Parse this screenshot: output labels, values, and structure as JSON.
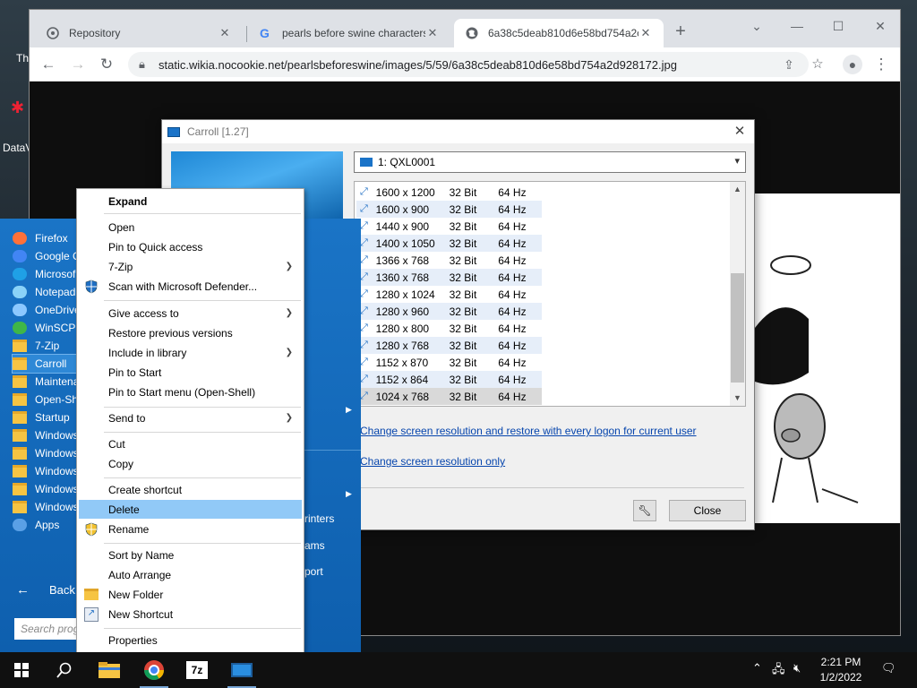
{
  "desktop": {
    "icons": [
      {
        "label": "Th"
      },
      {
        "label": "DataV"
      }
    ]
  },
  "browser": {
    "tabs": [
      {
        "label": "Repository",
        "icon": "repo-icon"
      },
      {
        "label": "pearls before swine characters -",
        "icon": "google-icon"
      },
      {
        "label": "6a38c5deab810d6e58bd754a2c",
        "icon": "globe-icon",
        "active": true
      }
    ],
    "url": "static.wikia.nocookie.net/pearlsbeforeswine/images/5/59/6a38c5deab810d6e58bd754a2d928172.jpg"
  },
  "carroll": {
    "title": "Carroll [1.27]",
    "display": "1: QXL0001",
    "resolutions": [
      {
        "res": "1600 x 1200",
        "bits": "32 Bit",
        "hz": "64 Hz"
      },
      {
        "res": "1600 x 900",
        "bits": "32 Bit",
        "hz": "64 Hz"
      },
      {
        "res": "1440 x 900",
        "bits": "32 Bit",
        "hz": "64 Hz"
      },
      {
        "res": "1400 x 1050",
        "bits": "32 Bit",
        "hz": "64 Hz"
      },
      {
        "res": "1366 x 768",
        "bits": "32 Bit",
        "hz": "64 Hz"
      },
      {
        "res": "1360 x 768",
        "bits": "32 Bit",
        "hz": "64 Hz"
      },
      {
        "res": "1280 x 1024",
        "bits": "32 Bit",
        "hz": "64 Hz"
      },
      {
        "res": "1280 x 960",
        "bits": "32 Bit",
        "hz": "64 Hz"
      },
      {
        "res": "1280 x 800",
        "bits": "32 Bit",
        "hz": "64 Hz"
      },
      {
        "res": "1280 x 768",
        "bits": "32 Bit",
        "hz": "64 Hz"
      },
      {
        "res": "1152 x 870",
        "bits": "32 Bit",
        "hz": "64 Hz"
      },
      {
        "res": "1152 x 864",
        "bits": "32 Bit",
        "hz": "64 Hz"
      },
      {
        "res": "1024 x 768",
        "bits": "32 Bit",
        "hz": "64 Hz",
        "selected": true
      }
    ],
    "link_restore": "Change screen resolution and restore with every logon for current user",
    "link_only": "Change screen resolution only",
    "close_label": "Close"
  },
  "startmenu": {
    "items": [
      {
        "label": "Firefox",
        "icon": "firefox-icon"
      },
      {
        "label": "Google C",
        "icon": "chrome-icon"
      },
      {
        "label": "Microsof",
        "icon": "edge-icon"
      },
      {
        "label": "Notepad",
        "icon": "notepad-icon"
      },
      {
        "label": "OneDrive",
        "icon": "onedrive-icon"
      },
      {
        "label": "WinSCP",
        "icon": "winscp-icon"
      },
      {
        "label": "7-Zip",
        "icon": "folder-icon"
      },
      {
        "label": "Carroll",
        "icon": "folder-icon",
        "selected": true
      },
      {
        "label": "Maintena",
        "icon": "folder-icon"
      },
      {
        "label": "Open-Sh",
        "icon": "folder-icon"
      },
      {
        "label": "Startup",
        "icon": "folder-icon"
      },
      {
        "label": "Windows",
        "icon": "folder-icon"
      },
      {
        "label": "Windows",
        "icon": "folder-icon"
      },
      {
        "label": "Windows",
        "icon": "folder-icon"
      },
      {
        "label": "Windows",
        "icon": "folder-icon"
      },
      {
        "label": "Windows",
        "icon": "folder-icon"
      },
      {
        "label": "Apps",
        "icon": "apps-icon"
      }
    ],
    "back_label": "Back",
    "search_placeholder": "Search prog",
    "right_items": [
      "rinters",
      "ams",
      "port"
    ]
  },
  "context_menu": {
    "items": [
      {
        "label": "Expand",
        "bold": true
      },
      {
        "sep": true
      },
      {
        "label": "Open"
      },
      {
        "label": "Pin to Quick access"
      },
      {
        "label": "7-Zip",
        "submenu": true
      },
      {
        "label": "Scan with Microsoft Defender...",
        "icon": "defender-icon"
      },
      {
        "sep": true
      },
      {
        "label": "Give access to",
        "submenu": true
      },
      {
        "label": "Restore previous versions"
      },
      {
        "label": "Include in library",
        "submenu": true
      },
      {
        "label": "Pin to Start"
      },
      {
        "label": "Pin to Start menu (Open-Shell)"
      },
      {
        "sep": true
      },
      {
        "label": "Send to",
        "submenu": true
      },
      {
        "sep": true
      },
      {
        "label": "Cut"
      },
      {
        "label": "Copy"
      },
      {
        "sep": true
      },
      {
        "label": "Create shortcut"
      },
      {
        "label": "Delete",
        "highlighted": true
      },
      {
        "label": "Rename",
        "icon": "shield-icon"
      },
      {
        "sep": true
      },
      {
        "label": "Sort by Name"
      },
      {
        "label": "Auto Arrange"
      },
      {
        "label": "New Folder",
        "icon": "folder-icon"
      },
      {
        "label": "New Shortcut",
        "icon": "shortcut-icon"
      },
      {
        "sep": true
      },
      {
        "label": "Properties"
      }
    ]
  },
  "taskbar": {
    "time": "2:21 PM",
    "date": "1/2/2022",
    "apps": [
      "file-explorer-icon",
      "chrome-icon",
      "7zip-icon",
      "carroll-icon"
    ]
  }
}
